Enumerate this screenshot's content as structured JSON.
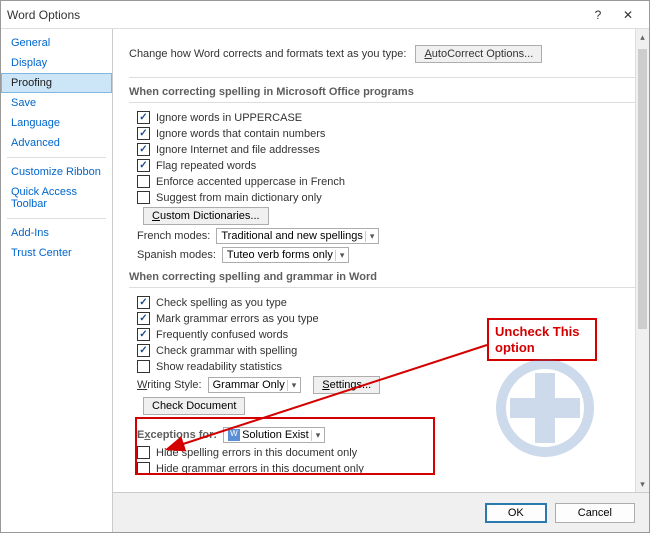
{
  "title": "Word Options",
  "titlebar": {
    "help": "?",
    "close": "✕"
  },
  "sidebar": {
    "items": [
      {
        "label": "General",
        "link": true
      },
      {
        "label": "Display",
        "link": true
      },
      {
        "label": "Proofing",
        "selected": true
      },
      {
        "label": "Save",
        "link": true
      },
      {
        "label": "Language",
        "link": true
      },
      {
        "label": "Advanced",
        "link": true
      }
    ],
    "group2": [
      {
        "label": "Customize Ribbon",
        "link": true
      },
      {
        "label": "Quick Access Toolbar",
        "link": true
      }
    ],
    "group3": [
      {
        "label": "Add-Ins",
        "link": true
      },
      {
        "label": "Trust Center",
        "link": true
      }
    ]
  },
  "topline": {
    "text": "Change how Word corrects and formats text as you type:",
    "btn": "AutoCorrect Options..."
  },
  "sec1": {
    "head": "When correcting spelling in Microsoft Office programs",
    "opts": [
      {
        "label": "Ignore words in UPPERCASE",
        "checked": true
      },
      {
        "label": "Ignore words that contain numbers",
        "checked": true
      },
      {
        "label": "Ignore Internet and file addresses",
        "checked": true
      },
      {
        "label": "Flag repeated words",
        "checked": true
      },
      {
        "label": "Enforce accented uppercase in French",
        "checked": false
      },
      {
        "label": "Suggest from main dictionary only",
        "checked": false
      }
    ],
    "dict_btn": "Custom Dictionaries...",
    "french_label": "French modes:",
    "french_val": "Traditional and new spellings",
    "spanish_label": "Spanish modes:",
    "spanish_val": "Tuteo verb forms only"
  },
  "sec2": {
    "head": "When correcting spelling and grammar in Word",
    "opts": [
      {
        "label": "Check spelling as you type",
        "checked": true
      },
      {
        "label": "Mark grammar errors as you type",
        "checked": true
      },
      {
        "label": "Frequently confused words",
        "checked": true
      },
      {
        "label": "Check grammar with spelling",
        "checked": true
      },
      {
        "label": "Show readability statistics",
        "checked": false
      }
    ],
    "ws_label": "Writing Style:",
    "ws_val": "Grammar Only",
    "settings_btn": "Settings...",
    "check_btn": "Check Document"
  },
  "sec3": {
    "head_label": "Exceptions for:",
    "doc_val": "Solution Exist",
    "opts": [
      {
        "label": "Hide spelling errors in this document only",
        "checked": false
      },
      {
        "label": "Hide grammar errors in this document only",
        "checked": false
      }
    ]
  },
  "footer": {
    "ok": "OK",
    "cancel": "Cancel"
  },
  "annotation": {
    "text": "Uncheck This option"
  }
}
